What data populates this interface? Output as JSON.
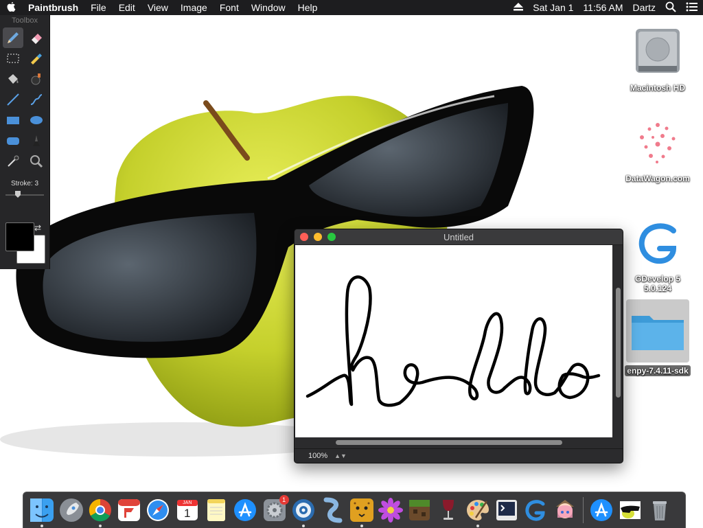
{
  "menubar": {
    "app_name": "Paintbrush",
    "menus": [
      "File",
      "Edit",
      "View",
      "Image",
      "Font",
      "Window",
      "Help"
    ],
    "date": "Sat Jan 1",
    "time": "11:56 AM",
    "user": "Dartz",
    "icons": [
      "apple-icon",
      "eject-icon",
      "search-icon",
      "list-icon"
    ]
  },
  "toolbox": {
    "title": "Toolbox",
    "tools": [
      "pencil",
      "eraser",
      "selection",
      "text",
      "paint-bucket",
      "airbrush",
      "line",
      "curve",
      "rectangle",
      "ellipse",
      "rounded-rectangle",
      "brush",
      "eyedropper",
      "zoom"
    ],
    "selected_tool": "pencil",
    "stroke_label": "Stroke: 3",
    "foreground_color": "#000000",
    "background_color": "#ffffff"
  },
  "desktop_icons": [
    {
      "label": "Macintosh HD",
      "icon": "hard-drive-icon"
    },
    {
      "label": "DataWagon.com",
      "icon": "datawagon-icon"
    },
    {
      "label": "GDevelop 5\n5.0.124",
      "icon": "gdevelop-icon"
    },
    {
      "label": "enpy-7.4.11-sdk",
      "icon": "folder-icon"
    }
  ],
  "window": {
    "title": "Untitled",
    "canvas_text_drawn": "hello",
    "zoom": "100%"
  },
  "dock": {
    "apps": [
      "Finder",
      "Launchpad",
      "Chrome",
      "Fantastical",
      "Safari",
      "Calendar",
      "Notes",
      "App Store",
      "System Preferences",
      "Network Radar",
      "Script Editor",
      "Cheetah",
      "Flower",
      "Minecraft",
      "Wine",
      "Paintbrush",
      "Terminal",
      "GDevelop",
      "Anime",
      "App Store 2",
      "Desktop",
      "Trash"
    ],
    "calendar_month": "JAN",
    "calendar_day": "1",
    "sys_prefs_badge": "1"
  }
}
